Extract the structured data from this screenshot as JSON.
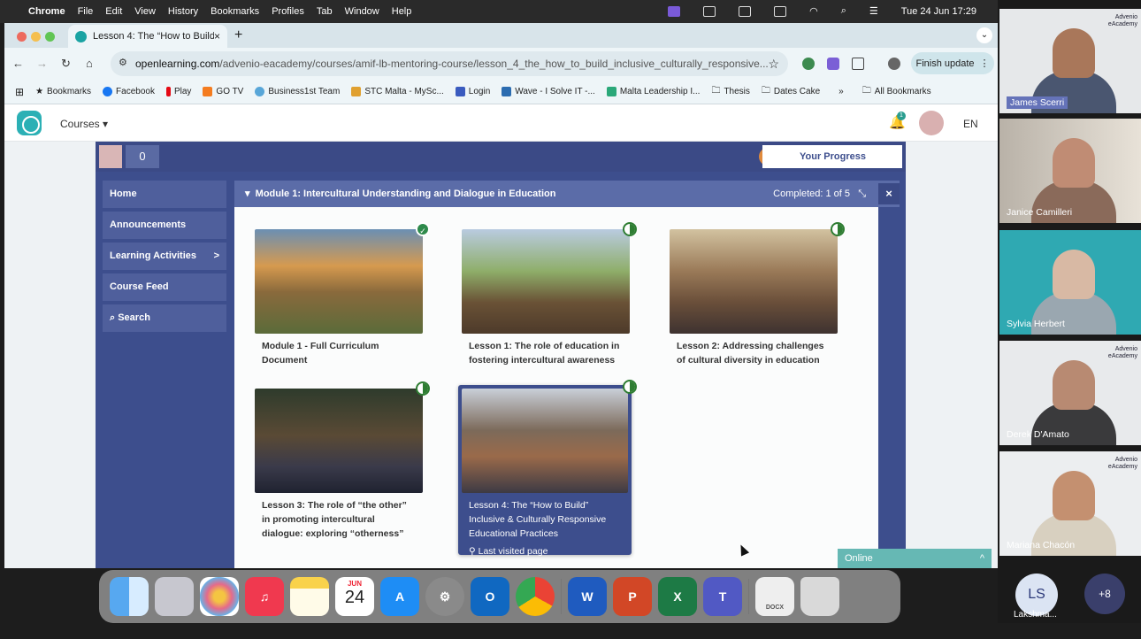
{
  "menubar": {
    "app": "Chrome",
    "items": [
      "File",
      "Edit",
      "View",
      "History",
      "Bookmarks",
      "Profiles",
      "Tab",
      "Window",
      "Help"
    ],
    "datetime": "Tue 24 Jun  17:29"
  },
  "tab": {
    "title": "Lesson 4: The “How to Build”",
    "close": "×",
    "new": "+"
  },
  "toolbar": {
    "url_host": "openlearning.com",
    "url_path": "/advenio-eacademy/courses/amif-lb-mentoring-course/lesson_4_the_how_to_build_inclusive_culturally_responsive...",
    "finish": "Finish update"
  },
  "bookmarks": [
    "Bookmarks",
    "Facebook",
    "Play",
    "GO TV",
    "Business1st Team",
    "STC Malta - MySc...",
    "Login",
    "Wave - I Solve IT -...",
    "Malta Leadership I...",
    "Thesis",
    "Dates Cake"
  ],
  "bookmarks_more": "»",
  "bookmarks_all": "All Bookmarks",
  "site": {
    "courses": "Courses ▾",
    "lang": "EN",
    "bell_badge": "1"
  },
  "course": {
    "count": "0",
    "progress": "Your Progress"
  },
  "sidebar": {
    "items": [
      {
        "label": "Home"
      },
      {
        "label": "Announcements"
      },
      {
        "label": "Learning Activities",
        "chev": ">"
      },
      {
        "label": "Course Feed"
      },
      {
        "label": "Search",
        "icon": "search-icon"
      }
    ]
  },
  "module": {
    "title": "Module 1: Intercultural Understanding and Dialogue in Education",
    "completed": "Completed: 1 of 5",
    "close": "×",
    "arrow": "▾",
    "minimize": "⤡"
  },
  "cards": [
    {
      "title": "Module 1 - Full Curriculum Document",
      "status": "complete"
    },
    {
      "title": "Lesson 1: The role of education in fostering intercultural awareness",
      "status": "partial"
    },
    {
      "title": "Lesson 2: Addressing challenges of cultural diversity in education",
      "status": "partial"
    },
    {
      "title": "Lesson 3: The role of “the other” in promoting intercultural dialogue: exploring “otherness”",
      "status": "partial"
    },
    {
      "title": "Lesson 4: The “How to Build” Inclusive & Culturally Responsive Educational Practices",
      "status": "partial",
      "note": "Last visited page"
    }
  ],
  "online": {
    "label": "Online",
    "chev": "^"
  },
  "dock": {
    "calendar_month": "JUN",
    "calendar_day": "24",
    "doc_label": "DOCX"
  },
  "participants": [
    {
      "name": "James Scerri",
      "highlight": true
    },
    {
      "name": "Janice Camilleri"
    },
    {
      "name": "Sylvia Herbert"
    },
    {
      "name": "Derek D'Amato"
    },
    {
      "name": "Mariana Chacón"
    }
  ],
  "participant_logo": "Advenio eAcademy Further & Higher Education Institution",
  "extra": {
    "initials": "LS",
    "name": "Lakshma...",
    "more": "+8"
  },
  "colors": {
    "course_bg": "#3d4e8d",
    "module_header": "#5b6ca8",
    "online": "#66b8b4",
    "complete": "#2e8a4b"
  }
}
